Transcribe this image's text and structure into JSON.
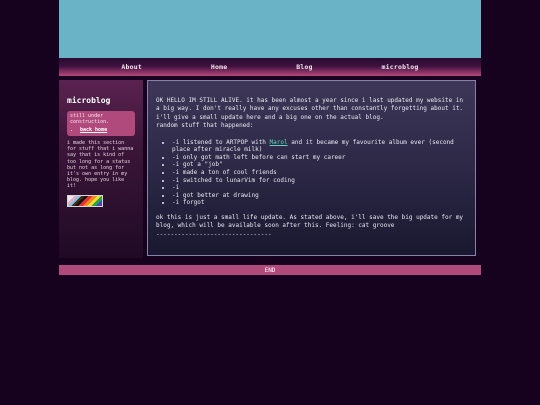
{
  "nav": {
    "items": [
      {
        "label": "About"
      },
      {
        "label": "Home"
      },
      {
        "label": "Blog"
      },
      {
        "label": "microblog"
      }
    ]
  },
  "sidebar": {
    "title": "microblog",
    "status_text": "still under construction.",
    "back_link": "back home",
    "description": "i made this section for stuff that i wanna say that is kind of too long for a status but not as long for it's own entry in my blog. hope you like it!",
    "flag_icon": "progress-pride-flag-icon"
  },
  "post": {
    "intro": "OK HELLO IM STILL ALIVE. it has been almost a year since i last updated my website in a big way. I don't really have any excuses other than constantly forgetting about it. i'll give a small update here and a big one on the actual blog.",
    "subheading": "random stuff that happened:",
    "list": [
      {
        "before": "-i listened to ARTPOP with ",
        "link": "Marol",
        "after": " and it became my favourite album ever (second place after miracle milk)"
      },
      {
        "before": "-i only got math left before can start my career"
      },
      {
        "before": "-i got a \"job\""
      },
      {
        "before": "-i made a ton of cool friends"
      },
      {
        "before": "-i switched to lunarVim for coding"
      },
      {
        "before": "-i"
      },
      {
        "before": "-i got better at drawing"
      },
      {
        "before": "-i forgot"
      }
    ],
    "outro": "ok this is just a small life update. As stated above, i'll save the big update for my blog, which will be available soon after this. Feeling: cat groove",
    "divider": "--------------------------------"
  },
  "footer": {
    "label": "END"
  },
  "colors": {
    "background": "#16021f",
    "banner": "#6ab2c6",
    "accent_pink": "#b04a7c",
    "link": "#5fd2b8"
  }
}
